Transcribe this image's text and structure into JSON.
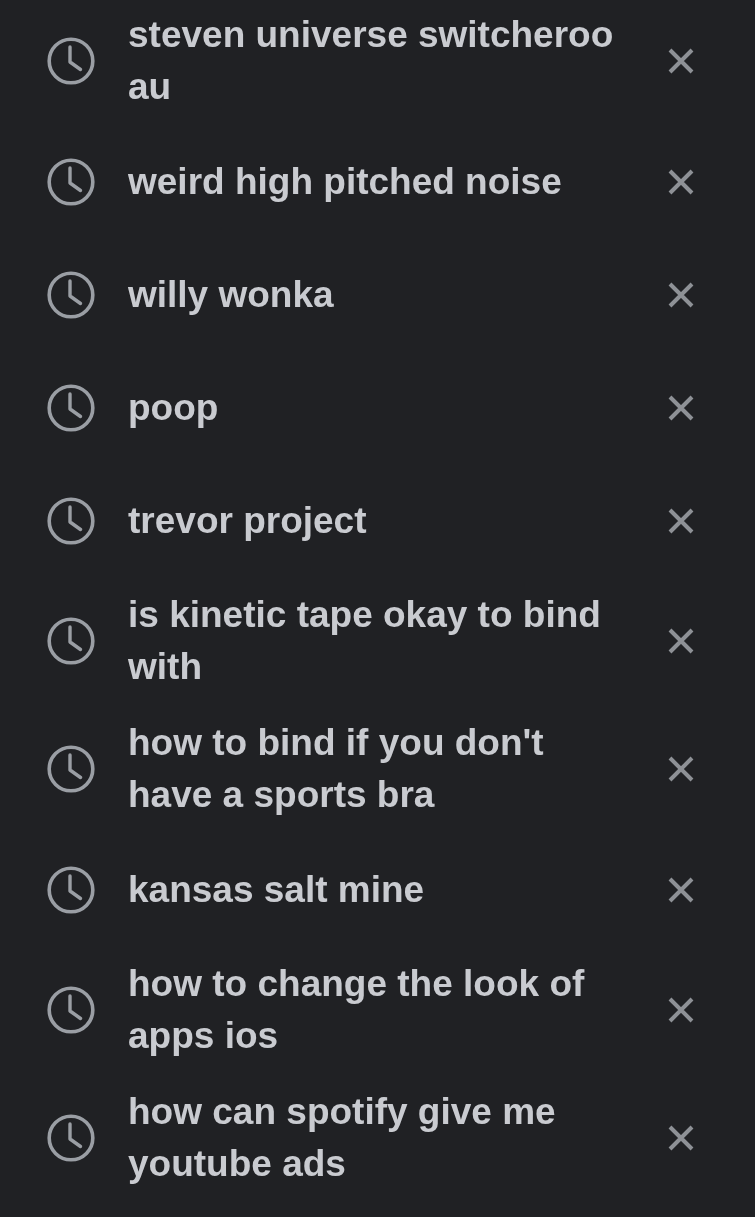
{
  "history": [
    {
      "query": "steven universe switcheroo au"
    },
    {
      "query": "weird high pitched noise"
    },
    {
      "query": "willy wonka"
    },
    {
      "query": "poop"
    },
    {
      "query": "trevor project"
    },
    {
      "query": "is kinetic tape okay to bind with"
    },
    {
      "query": "how to bind if you don't have a sports bra"
    },
    {
      "query": "kansas salt mine"
    },
    {
      "query": "how to change the look of apps ios"
    },
    {
      "query": "how can spotify give me youtube ads"
    }
  ]
}
